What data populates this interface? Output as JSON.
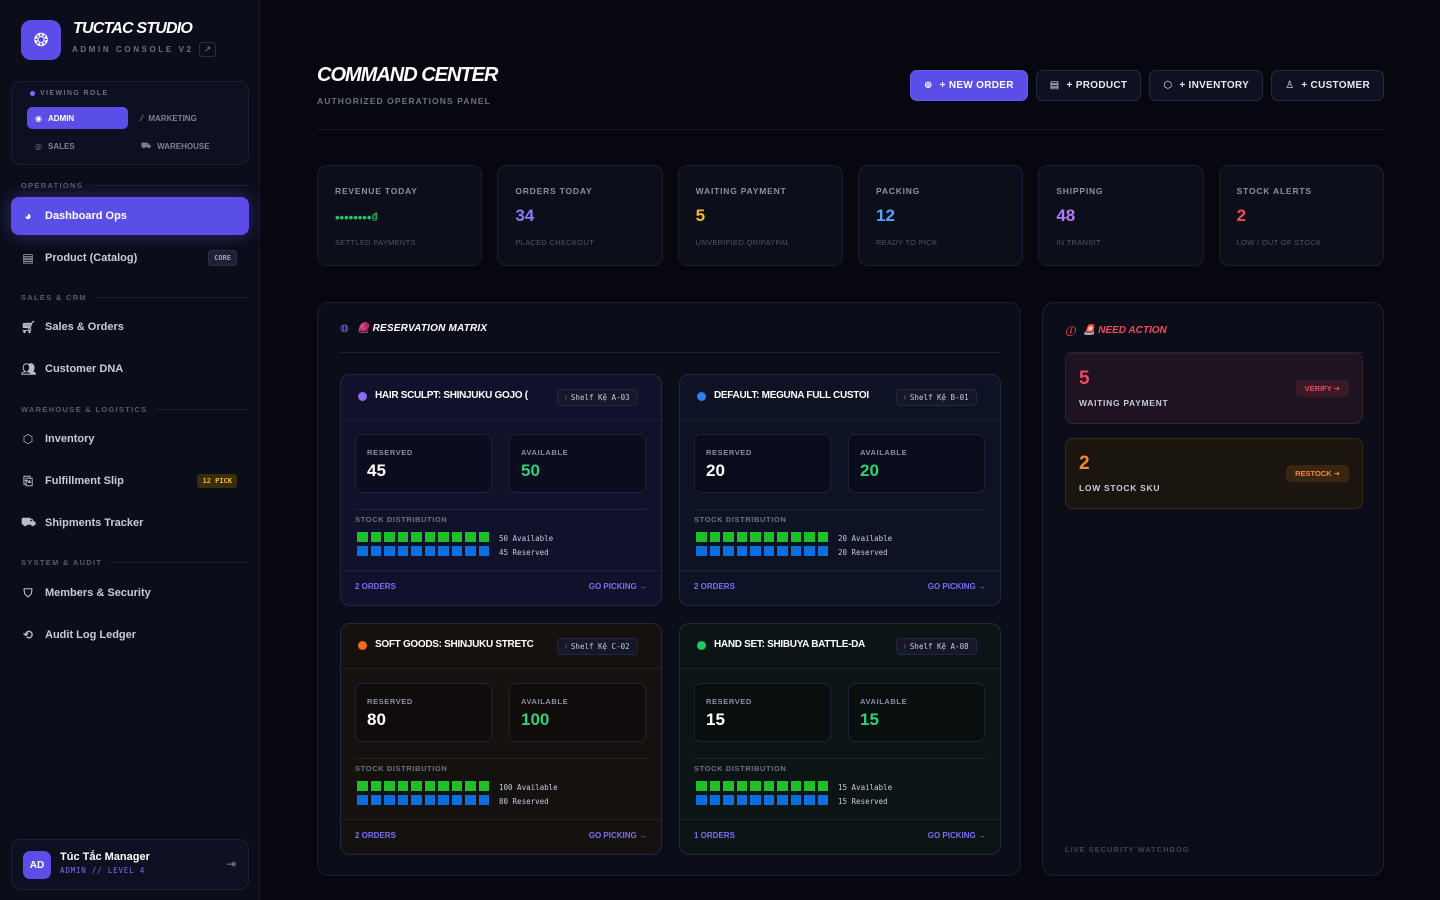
{
  "brand": {
    "name": "TUCTAC STUDIO",
    "subtitle": "ADMIN CONSOLE V2"
  },
  "role": {
    "title": "VIEWING ROLE",
    "options": [
      {
        "label": "ADMIN",
        "active": true
      },
      {
        "label": "MARKETING",
        "active": false
      },
      {
        "label": "SALES",
        "active": false
      },
      {
        "label": "WAREHOUSE",
        "active": false
      }
    ]
  },
  "nav": {
    "sections": [
      "OPERATIONS",
      "SALES & CRM",
      "WAREHOUSE & LOGISTICS",
      "SYSTEM & AUDIT"
    ],
    "items": [
      {
        "label": "Dashboard Ops",
        "icon": "dashboard-icon",
        "active": true
      },
      {
        "label": "Product (Catalog)",
        "icon": "catalog-icon",
        "badge": "CORE"
      },
      {
        "label": "Sales & Orders",
        "icon": "cart-icon"
      },
      {
        "label": "Customer DNA",
        "icon": "users-icon"
      },
      {
        "label": "Inventory",
        "icon": "box-icon"
      },
      {
        "label": "Fulfillment Slip",
        "icon": "slip-icon",
        "badge": "12 PICK"
      },
      {
        "label": "Shipments Tracker",
        "icon": "truck-icon"
      },
      {
        "label": "Members & Security",
        "icon": "shield-icon"
      },
      {
        "label": "Audit Log Ledger",
        "icon": "history-icon"
      }
    ]
  },
  "user": {
    "initials": "AD",
    "name": "Túc Tắc Manager",
    "role": "ADMIN // LEVEL 4"
  },
  "header": {
    "title": "COMMAND CENTER",
    "subtitle": "AUTHORIZED OPERATIONS PANEL",
    "actions": [
      "+ NEW ORDER",
      "+ PRODUCT",
      "+ INVENTORY",
      "+ CUSTOMER"
    ]
  },
  "kpis": [
    {
      "label": "REVENUE TODAY",
      "value": "••••••••₫",
      "sub": "SETTLED PAYMENTS",
      "color": "#22c55e"
    },
    {
      "label": "ORDERS TODAY",
      "value": "34",
      "sub": "PLACED CHECKOUT",
      "color": "#8b7cf6"
    },
    {
      "label": "WAITING PAYMENT",
      "value": "5",
      "sub": "UNVERIFIED QR/PAYPAL",
      "color": "#f5b82e"
    },
    {
      "label": "PACKING",
      "value": "12",
      "sub": "READY TO PICK",
      "color": "#5aa2ff"
    },
    {
      "label": "SHIPPING",
      "value": "48",
      "sub": "IN TRANSIT",
      "color": "#b07cf6"
    },
    {
      "label": "STOCK ALERTS",
      "value": "2",
      "sub": "LOW / OUT OF STOCK",
      "color": "#ef4b5c"
    }
  ],
  "matrix": {
    "title": "🧶 RESERVATION MATRIX",
    "labels": {
      "reserved": "RESERVED",
      "available": "AVAILABLE",
      "distribution": "STOCK DISTRIBUTION",
      "go_picking": "GO PICKING →"
    },
    "cards": [
      {
        "name": "HAIR SCULPT: SHINJUKU GOJO (",
        "shelf": "Shelf Kệ A-03",
        "reserved": "45",
        "available": "50",
        "avail_line": "50 Available",
        "res_line": "45 Reserved",
        "orders": "2 ORDERS",
        "dot": "#8b6cf0",
        "bg": "#10112a"
      },
      {
        "name": "DEFAULT: MEGUNA FULL CUSTOI",
        "shelf": "Shelf Kệ B-01",
        "reserved": "20",
        "available": "20",
        "avail_line": "20 Available",
        "res_line": "20 Reserved",
        "orders": "2 ORDERS",
        "dot": "#2d7cf0",
        "bg": "#0d1224"
      },
      {
        "name": "SOFT GOODS: SHINJUKU STRETC",
        "shelf": "Shelf Kệ C-02",
        "reserved": "80",
        "available": "100",
        "avail_line": "100 Available",
        "res_line": "80 Reserved",
        "orders": "2 ORDERS",
        "dot": "#f36a1c",
        "bg": "#15110f"
      },
      {
        "name": "HAND SET: SHIBUYA BATTLE-DA",
        "shelf": "Shelf Kệ A-08",
        "reserved": "15",
        "available": "15",
        "avail_line": "15 Available",
        "res_line": "15 Reserved",
        "orders": "1 ORDERS",
        "dot": "#22c55e",
        "bg": "#0c1515"
      }
    ]
  },
  "need_action": {
    "title": "🚨 NEED ACTION",
    "alerts": [
      {
        "count": "5",
        "label": "WAITING PAYMENT",
        "button": "VERIFY ➜",
        "color": "#ef4b5c"
      },
      {
        "count": "2",
        "label": "LOW STOCK SKU",
        "button": "RESTOCK ➜",
        "color": "#f38b2c"
      }
    ],
    "footer": "LIVE SECURITY WATCHDOG"
  }
}
